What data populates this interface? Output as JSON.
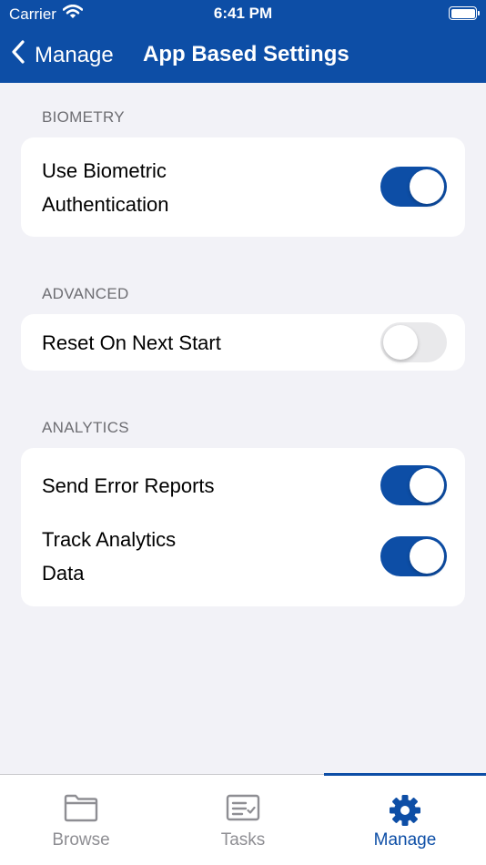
{
  "status_bar": {
    "carrier": "Carrier",
    "time": "6:41 PM"
  },
  "nav": {
    "back_label": "Manage",
    "title": "App Based Settings"
  },
  "sections": [
    {
      "header": "BIOMETRY",
      "rows": [
        {
          "label_lines": [
            "Use Biometric",
            "Authentication"
          ],
          "enabled": true
        }
      ]
    },
    {
      "header": "ADVANCED",
      "rows": [
        {
          "label_lines": [
            "Reset On Next Start"
          ],
          "enabled": false
        }
      ]
    },
    {
      "header": "ANALYTICS",
      "rows": [
        {
          "label_lines": [
            "Send Error Reports"
          ],
          "enabled": true
        },
        {
          "label_lines": [
            "Track Analytics",
            "Data"
          ],
          "enabled": true
        }
      ]
    }
  ],
  "tabs": [
    {
      "label": "Browse",
      "icon": "folder-icon",
      "active": false
    },
    {
      "label": "Tasks",
      "icon": "tasks-icon",
      "active": false
    },
    {
      "label": "Manage",
      "icon": "gear-icon",
      "active": true
    }
  ],
  "colors": {
    "brand": "#0d4ea6",
    "background": "#f2f2f7",
    "toggle_off": "#e9e9eb",
    "tab_inactive": "#8e8e93"
  }
}
